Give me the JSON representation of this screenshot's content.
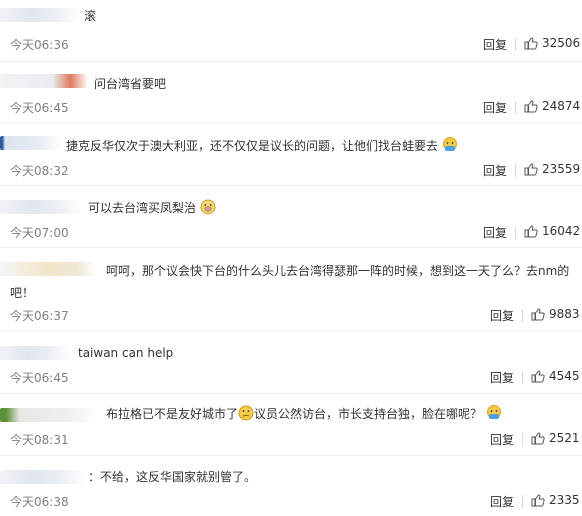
{
  "comments": [
    {
      "text": "滚",
      "time": "今天06:36",
      "reply_label": "回复",
      "likes": "32506"
    },
    {
      "text": "问台湾省要吧",
      "time": "今天06:45",
      "reply_label": "回复",
      "likes": "24874"
    },
    {
      "text": "捷克反华仅次于澳大利亚，还不仅仅是议长的问题，让他们找台蛙要去",
      "time": "今天08:32",
      "reply_label": "回复",
      "likes": "23559"
    },
    {
      "text": "可以去台湾买凤梨治",
      "time": "今天07:00",
      "reply_label": "回复",
      "likes": "16042"
    },
    {
      "text": "呵呵，那个议会快下台的什么头儿去台湾得瑟那一阵的时候，想到这一天了么？去nm的吧！",
      "time": "今天06:37",
      "reply_label": "回复",
      "likes": "9883"
    },
    {
      "text": "taiwan can help",
      "time": "今天06:45",
      "reply_label": "回复",
      "likes": "4545"
    },
    {
      "text_a": "布拉格已不是友好城市了",
      "text_b": "议员公然访台，市长支持台独，脸在哪呢？",
      "time": "今天08:31",
      "reply_label": "回复",
      "likes": "2521"
    },
    {
      "text": "：不给，这反华国家就别管了。",
      "time": "今天06:38",
      "reply_label": "回复",
      "likes": "2335"
    }
  ],
  "icons": {
    "like": "thumbs-up-icon",
    "emoji_facepalm": "facepalm-emoji-icon",
    "emoji_pig": "pig-face-emoji-icon",
    "emoji_thinking": "thinking-emoji-icon"
  }
}
